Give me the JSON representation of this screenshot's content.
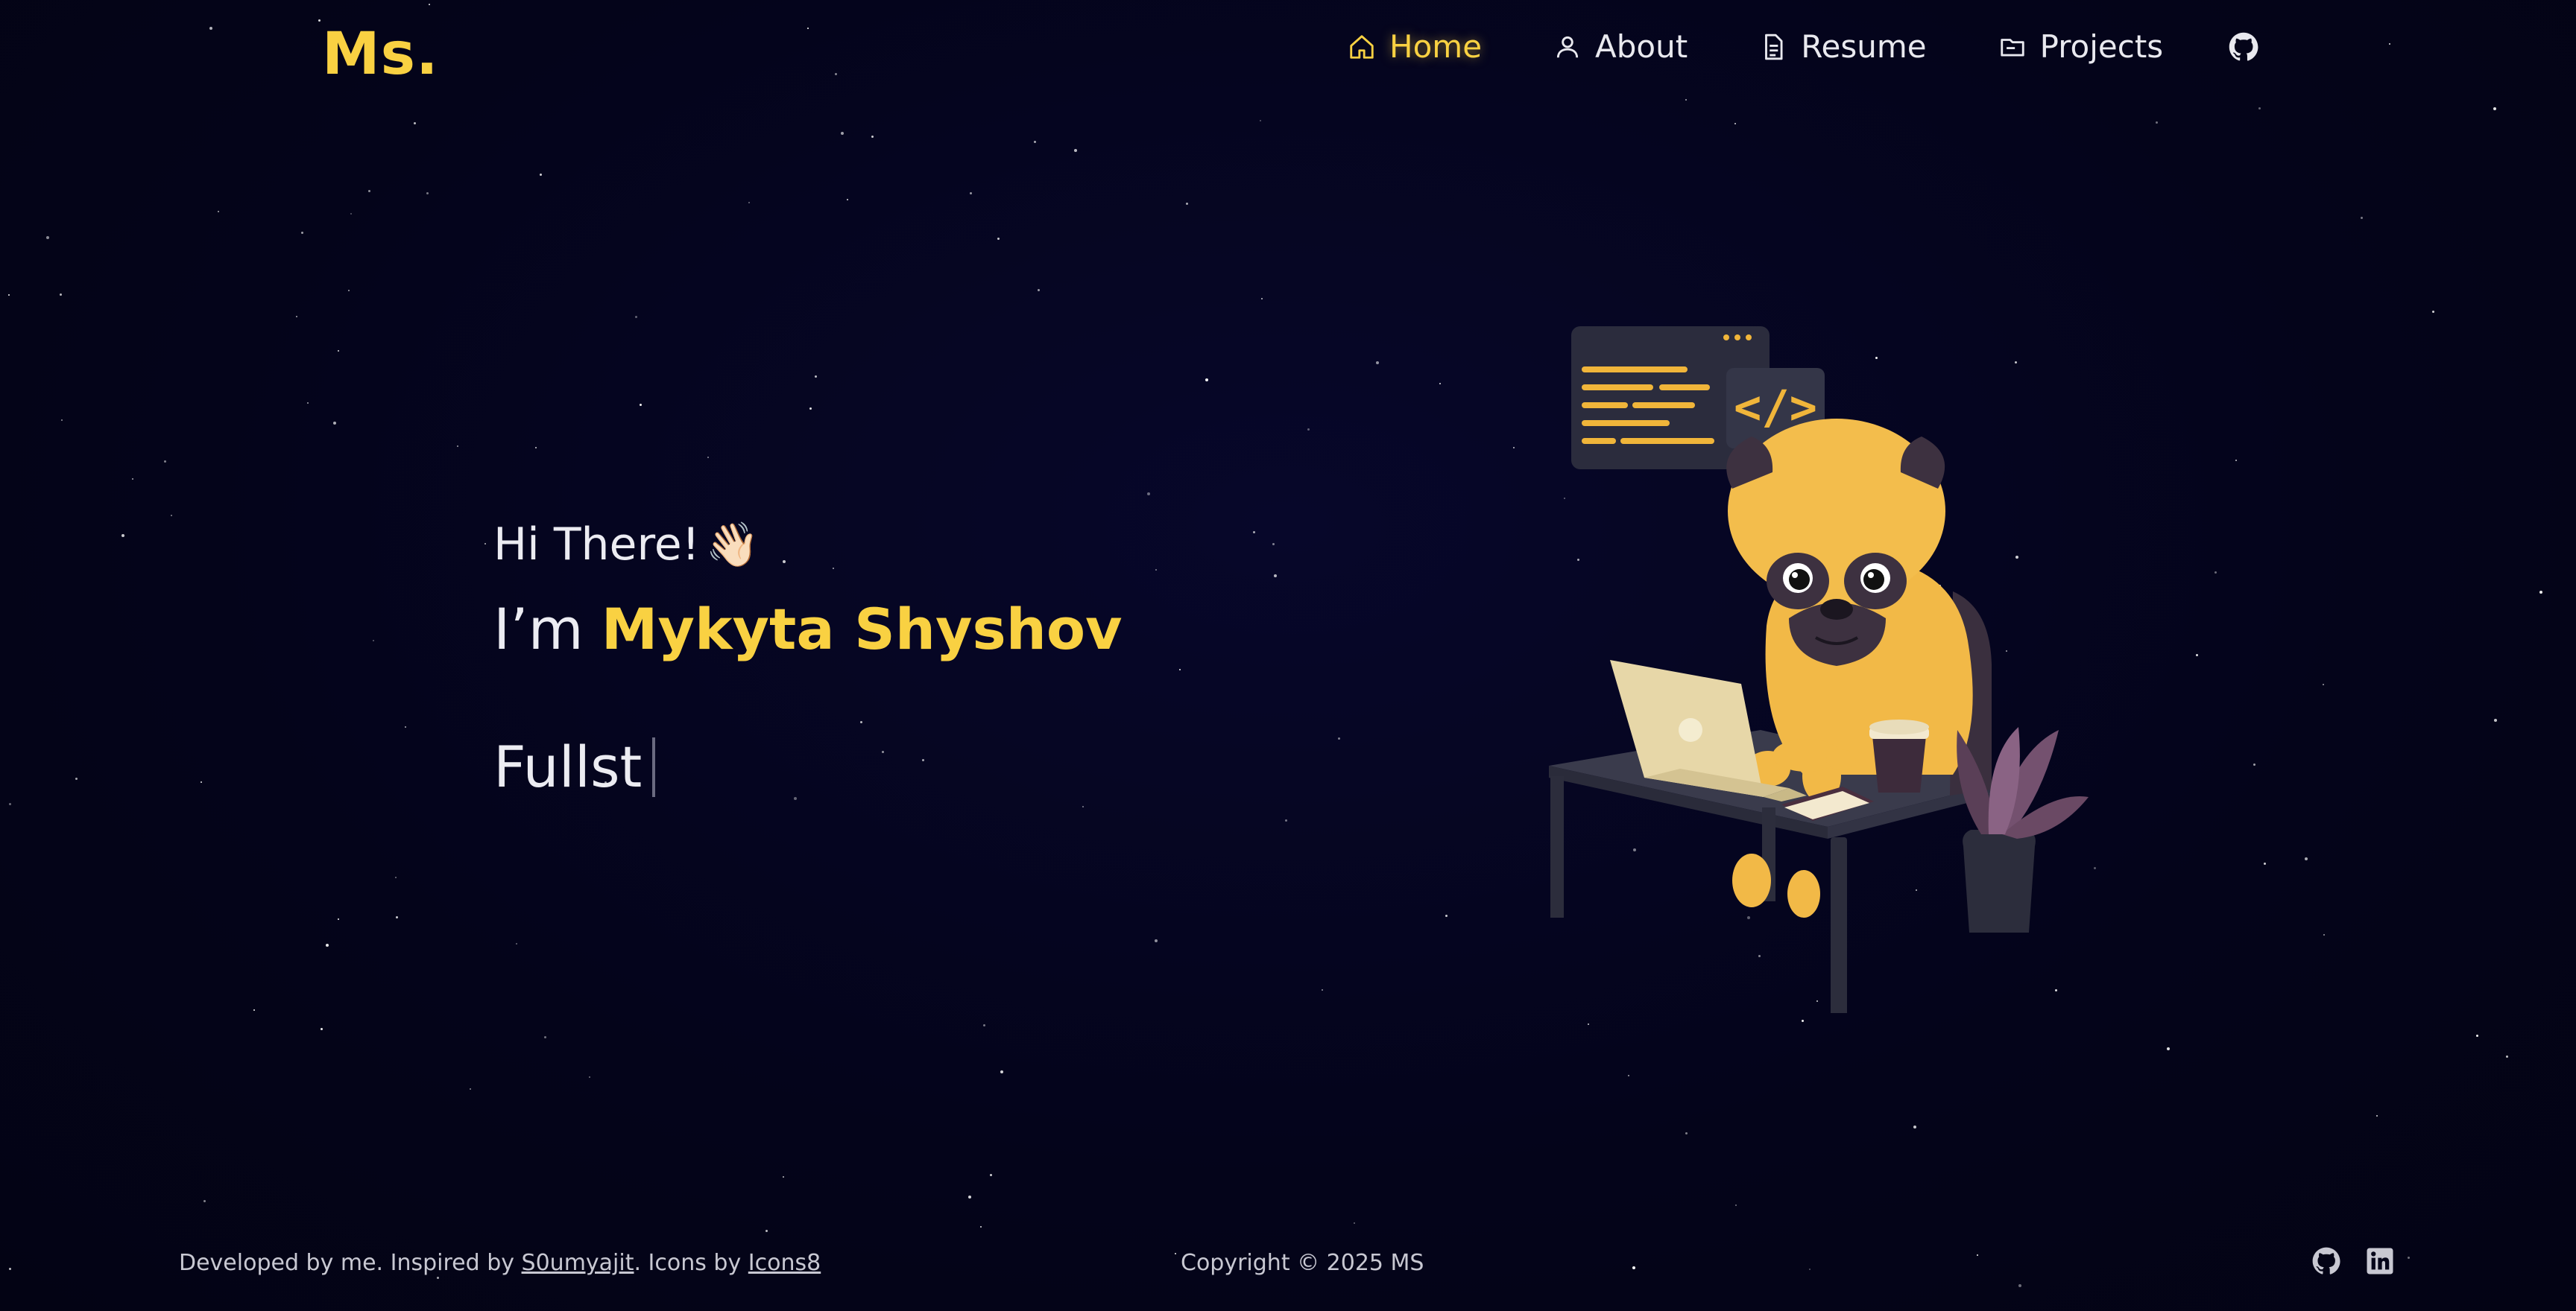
{
  "brand": {
    "logo": "Ms.",
    "accent_color": "#f9d142"
  },
  "nav": {
    "items": [
      {
        "label": "Home",
        "icon": "home-icon",
        "active": true
      },
      {
        "label": "About",
        "icon": "user-icon",
        "active": false
      },
      {
        "label": "Resume",
        "icon": "document-icon",
        "active": false
      },
      {
        "label": "Projects",
        "icon": "folder-icon",
        "active": false
      }
    ],
    "github_icon": "github-icon"
  },
  "hero": {
    "greeting": "Hi There!",
    "wave_emoji": "👋🏻",
    "intro_prefix": "I’m",
    "name": "Mykyta Shyshov",
    "typed_text": "Fullst"
  },
  "footer": {
    "credit_prefix": "Developed by me. Inspired by",
    "credit_link": "S0umyajit",
    "icons_prefix": ". Icons by",
    "icons_link": "Icons8",
    "copyright": "Copyright © 2025 MS",
    "social_icons": [
      "github-icon",
      "linkedin-icon"
    ]
  },
  "illustration": {
    "code_symbol": "</>"
  }
}
